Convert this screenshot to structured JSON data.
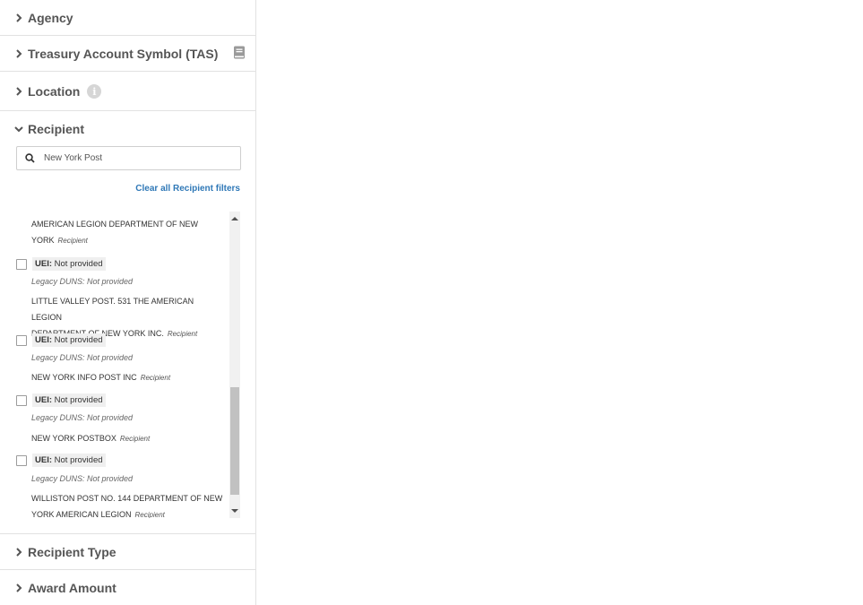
{
  "sidebar": {
    "agency": "Agency",
    "tas": "Treasury Account Symbol (TAS)",
    "location": "Location",
    "recipient": "Recipient",
    "recipient_type": "Recipient Type",
    "award_amount": "Award Amount",
    "info_glyph": "i"
  },
  "recipient_search": {
    "value": "New York Post",
    "clear_link": "Clear all Recipient filters"
  },
  "recipients": [
    {
      "name_line1": "AMERICAN LEGION DEPARTMENT OF NEW",
      "name_line2": "YORK",
      "tag": "Recipient"
    },
    {
      "uei_label": "UEI:",
      "uei_value": "Not provided",
      "duns": "Legacy DUNS: Not provided",
      "name_line1": "LITTLE VALLEY POST. 531 THE AMERICAN LEGION",
      "name_line2": "DEPARTMENT OF NEW YORK INC.",
      "tag": "Recipient"
    },
    {
      "uei_label": "UEI:",
      "uei_value": "Not provided",
      "duns": "Legacy DUNS: Not provided",
      "name_line1": "NEW YORK INFO POST INC",
      "tag": "Recipient"
    },
    {
      "uei_label": "UEI:",
      "uei_value": "Not provided",
      "duns": "Legacy DUNS: Not provided",
      "name_line1": "NEW YORK POSTBOX",
      "tag": "Recipient"
    },
    {
      "uei_label": "UEI:",
      "uei_value": "Not provided",
      "duns": "Legacy DUNS: Not provided",
      "name_line1": "WILLISTON POST NO. 144 DEPARTMENT OF NEW",
      "name_line2": "YORK AMERICAN LEGION",
      "tag": "Recipient"
    }
  ]
}
